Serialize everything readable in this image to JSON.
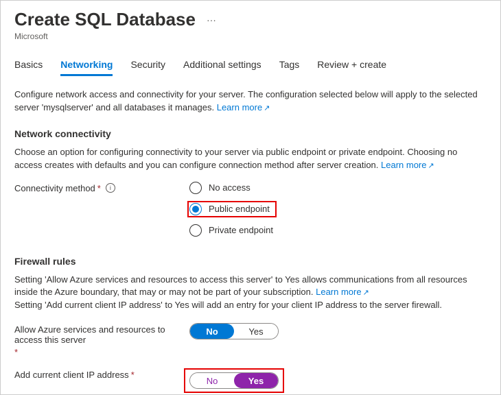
{
  "header": {
    "title": "Create SQL Database",
    "subtitle": "Microsoft"
  },
  "tabs": {
    "items": [
      {
        "label": "Basics"
      },
      {
        "label": "Networking"
      },
      {
        "label": "Security"
      },
      {
        "label": "Additional settings"
      },
      {
        "label": "Tags"
      },
      {
        "label": "Review + create"
      }
    ]
  },
  "intro": {
    "text": "Configure network access and connectivity for your server. The configuration selected below will apply to the selected server 'mysqlserver' and all databases it manages. ",
    "learn_more": "Learn more"
  },
  "connectivity": {
    "heading": "Network connectivity",
    "desc": "Choose an option for configuring connectivity to your server via public endpoint or private endpoint. Choosing no access creates with defaults and you can configure connection method after server creation. ",
    "learn_more": "Learn more",
    "label": "Connectivity method",
    "options": {
      "no_access": "No access",
      "public": "Public endpoint",
      "private": "Private endpoint"
    }
  },
  "firewall": {
    "heading": "Firewall rules",
    "desc1": "Setting 'Allow Azure services and resources to access this server' to Yes allows communications from all resources inside the Azure boundary, that may or may not be part of your subscription. ",
    "learn_more": "Learn more",
    "desc2": "Setting 'Add current client IP address' to Yes will add an entry for your client IP address to the server firewall.",
    "allow_label": "Allow Azure services and resources to access this server",
    "addip_label": "Add current client IP address",
    "no": "No",
    "yes": "Yes"
  }
}
